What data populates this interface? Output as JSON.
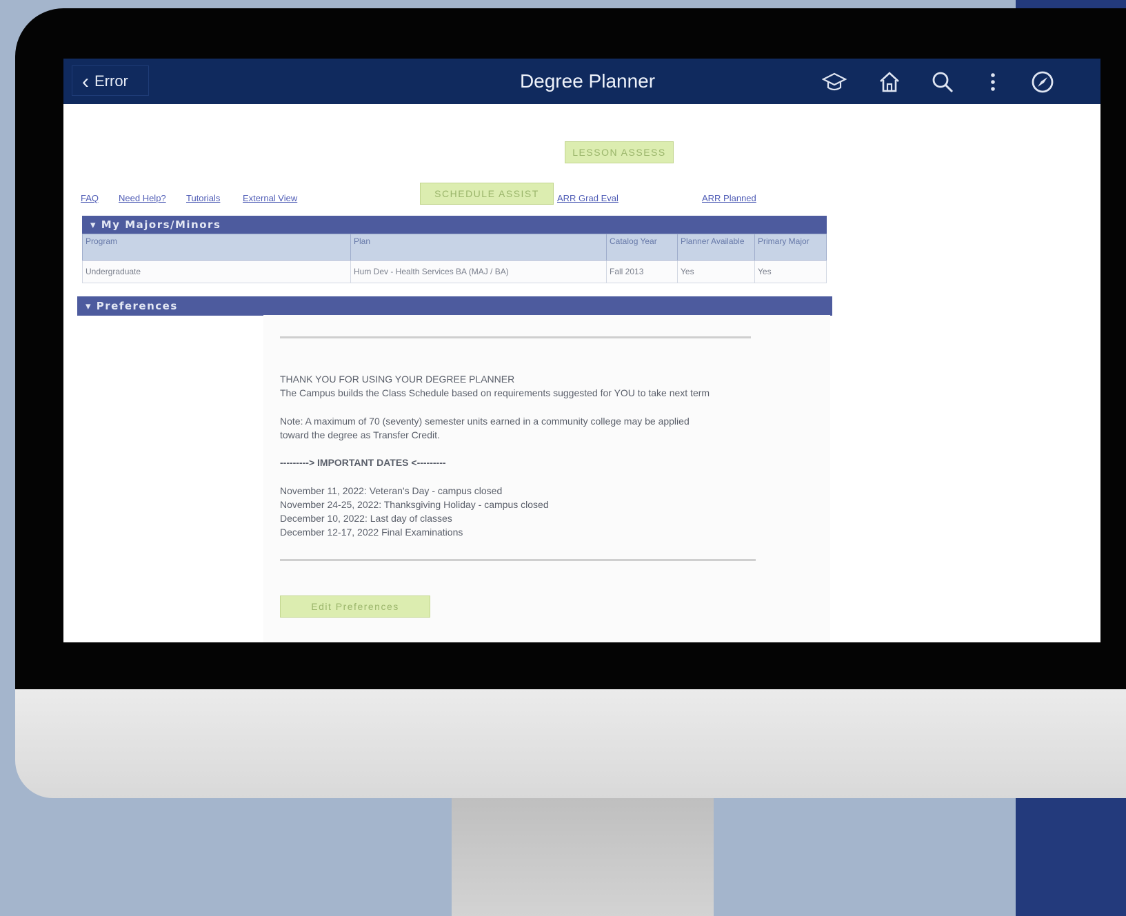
{
  "header": {
    "back_label": "Error",
    "title": "Degree Planner",
    "icons": [
      "graduation-cap-icon",
      "home-icon",
      "search-icon",
      "more-vertical-icon",
      "navigator-compass-icon"
    ]
  },
  "buttons": {
    "top": "LESSON ASSESS",
    "schedule": "SCHEDULE ASSIST",
    "edit_preferences": "Edit Preferences"
  },
  "links": [
    "FAQ",
    "Need Help?",
    "Tutorials",
    "External View"
  ],
  "right_links": {
    "grad_eval": "ARR Grad Eval",
    "planned": "ARR Planned"
  },
  "majors": {
    "title": "My Majors/Minors",
    "headers": [
      "Program",
      "Plan",
      "Catalog Year",
      "Planner Available",
      "Primary Major"
    ],
    "rows": [
      [
        "Undergraduate",
        "Hum Dev - Health Services BA (MAJ / BA)",
        "Fall 2013",
        "Yes",
        "Yes"
      ]
    ]
  },
  "preferences": {
    "title": "Preferences",
    "line1": "THANK YOU FOR USING YOUR DEGREE PLANNER",
    "line2": "The Campus builds the Class Schedule based on requirements suggested for YOU to take next term",
    "note1": "Note: A maximum of 70 (seventy) semester units earned in a community college may be applied",
    "note2": "toward the degree as Transfer Credit.",
    "dates_heading": "---------> IMPORTANT DATES <---------",
    "dates": [
      "November 11, 2022: Veteran's Day - campus closed",
      "November 24-25, 2022: Thanksgiving Holiday - campus closed",
      "December 10, 2022: Last day of classes",
      "December 12-17, 2022 Final Examinations"
    ]
  },
  "colors": {
    "header_bg": "#102a5e",
    "section_bar": "#4d5b9e",
    "button_green": "#dcedb0",
    "backdrop": "#a4b5cc",
    "side_bar": "#233a7c"
  }
}
